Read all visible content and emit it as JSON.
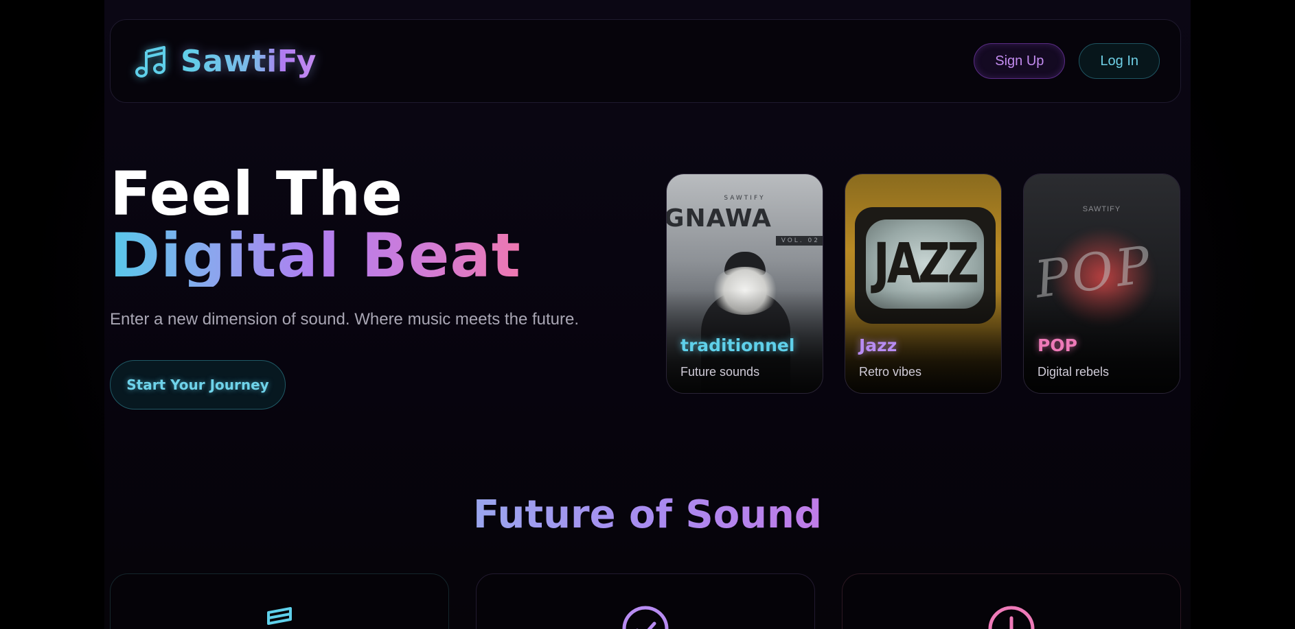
{
  "brand": {
    "name": "SawtiFy",
    "icon": "music-note-icon"
  },
  "nav": {
    "signup_label": "Sign Up",
    "login_label": "Log In"
  },
  "hero": {
    "title_line1": "Feel The",
    "title_line2": "Digital Beat",
    "subtitle": "Enter a new dimension of sound. Where music meets the future.",
    "cta_label": "Start Your Journey"
  },
  "cards": [
    {
      "title": "traditionnel",
      "subtitle": "Future sounds",
      "art": {
        "small": "SAWTIFY",
        "word": "GNAWA",
        "vol": "VOL. 02"
      }
    },
    {
      "title": "Jazz",
      "subtitle": "Retro vibes",
      "art": {
        "word": "JAZZ"
      }
    },
    {
      "title": "POP",
      "subtitle": "Digital rebels",
      "art": {
        "small": "SAWTIFY",
        "word": "POP"
      }
    }
  ],
  "section": {
    "title": "Future of Sound"
  },
  "features": [
    {
      "icon": "music-icon"
    },
    {
      "icon": "check-circle-icon"
    },
    {
      "icon": "alert-circle-icon"
    }
  ],
  "colors": {
    "cyan": "#5fd0ea",
    "purple": "#b88cf2",
    "pink": "#ee7ab8",
    "background": "#07040e"
  }
}
